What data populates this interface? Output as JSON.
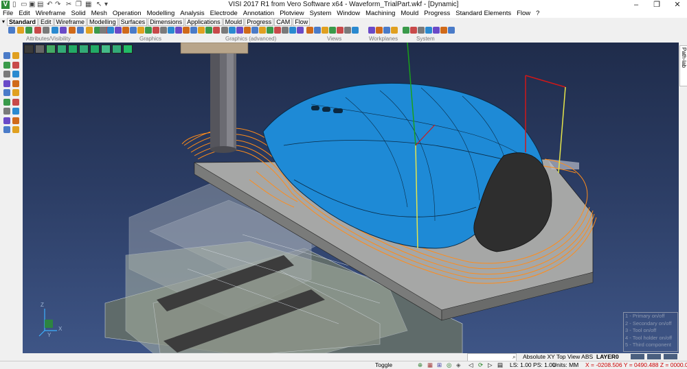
{
  "window": {
    "app_icon": "V",
    "title": "VISI 2017 R1   from Vero Software x64 - Waveform_TrialPart.wkf - [Dynamic]"
  },
  "menu": [
    "File",
    "Edit",
    "Wireframe",
    "Solid",
    "Mesh",
    "Operation",
    "Modelling",
    "Analysis",
    "Electrode",
    "Annotation",
    "Plotview",
    "System",
    "Window",
    "Machining",
    "Mould",
    "Progress",
    "Standard Elements",
    "Flow",
    "?"
  ],
  "ribbon_tabs": [
    "Standard",
    "Edit",
    "Wireframe",
    "Modelling",
    "Surfaces",
    "Dimensions",
    "Applications",
    "Mould",
    "Progress",
    "CAM",
    "Flow"
  ],
  "ribbon_active_tab": "Standard",
  "toolbar_groups": [
    "Attributes/Visibility",
    "Graphics",
    "Graphics (advanced)",
    "Views",
    "Workplanes",
    "System"
  ],
  "right_panel_tab": "Path-lab",
  "axis_labels": {
    "z": "Z",
    "x": "X",
    "y": "Y"
  },
  "viewport_legend": [
    "1 - Primary on/off",
    "2 - Secondary on/off",
    "3 - Tool on/off",
    "4 - Tool holder on/off",
    "5 - Third component"
  ],
  "status": {
    "view": "Absolute XY Top",
    "view_abs": "View ABS",
    "layer": "LAYER0",
    "toggle": "Toggle",
    "ls_ps": "LS: 1.00 PS: 1.00",
    "units": "Units: MM",
    "coords": "X = -0208.506 Y = 0490.488 Z = 0000.000"
  },
  "colors": {
    "part_blue": "#1e8ad6",
    "toolpath_orange": "#ff8c1a",
    "viewport_top": "#1f2c4b",
    "viewport_bottom": "#3e5586",
    "coords_red": "#cc0000"
  }
}
